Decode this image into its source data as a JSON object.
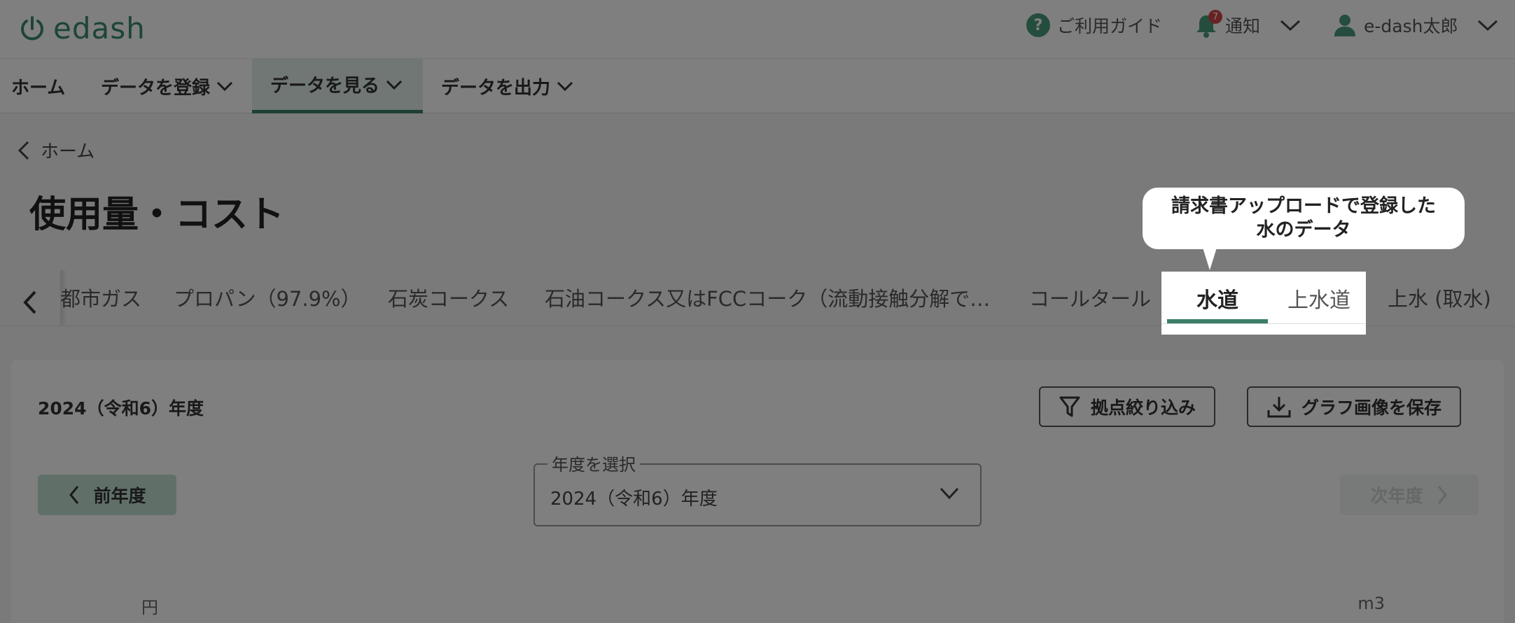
{
  "header": {
    "logo_text": "edash",
    "guide_label": "ご利用ガイド",
    "notifications_label": "通知",
    "notifications_count": "7",
    "user_name": "e-dash太郎"
  },
  "nav": {
    "items": [
      {
        "label": "ホーム"
      },
      {
        "label": "データを登録"
      },
      {
        "label": "データを見る"
      },
      {
        "label": "データを出力"
      }
    ]
  },
  "breadcrumb": {
    "back_label": "ホーム"
  },
  "page": {
    "title": "使用量・コスト"
  },
  "tabs": {
    "items": [
      {
        "label": "都市ガス"
      },
      {
        "label": "プロパン（97.9%）"
      },
      {
        "label": "石炭コークス"
      },
      {
        "label": "石油コークス又はFCCコーク（流動接触分解で…"
      },
      {
        "label": "コールタール"
      },
      {
        "label": "水道"
      },
      {
        "label": "上水道"
      },
      {
        "label": "上水 (取水)"
      }
    ],
    "active": "水道"
  },
  "tooltip": {
    "line1": "請求書アップロードで登録した",
    "line2": "水のデータ"
  },
  "card": {
    "year_label": "2024（令和6）年度",
    "filter_button": "拠点絞り込み",
    "save_button": "グラフ画像を保存",
    "prev_button": "前年度",
    "next_button": "次年度",
    "select_legend": "年度を選択",
    "select_value": "2024（令和6）年度",
    "unit_left": "円",
    "unit_right": "m3"
  },
  "colors": {
    "brand": "#3d7e67",
    "brand_light": "#c0e0d3",
    "badge": "#d04545"
  }
}
